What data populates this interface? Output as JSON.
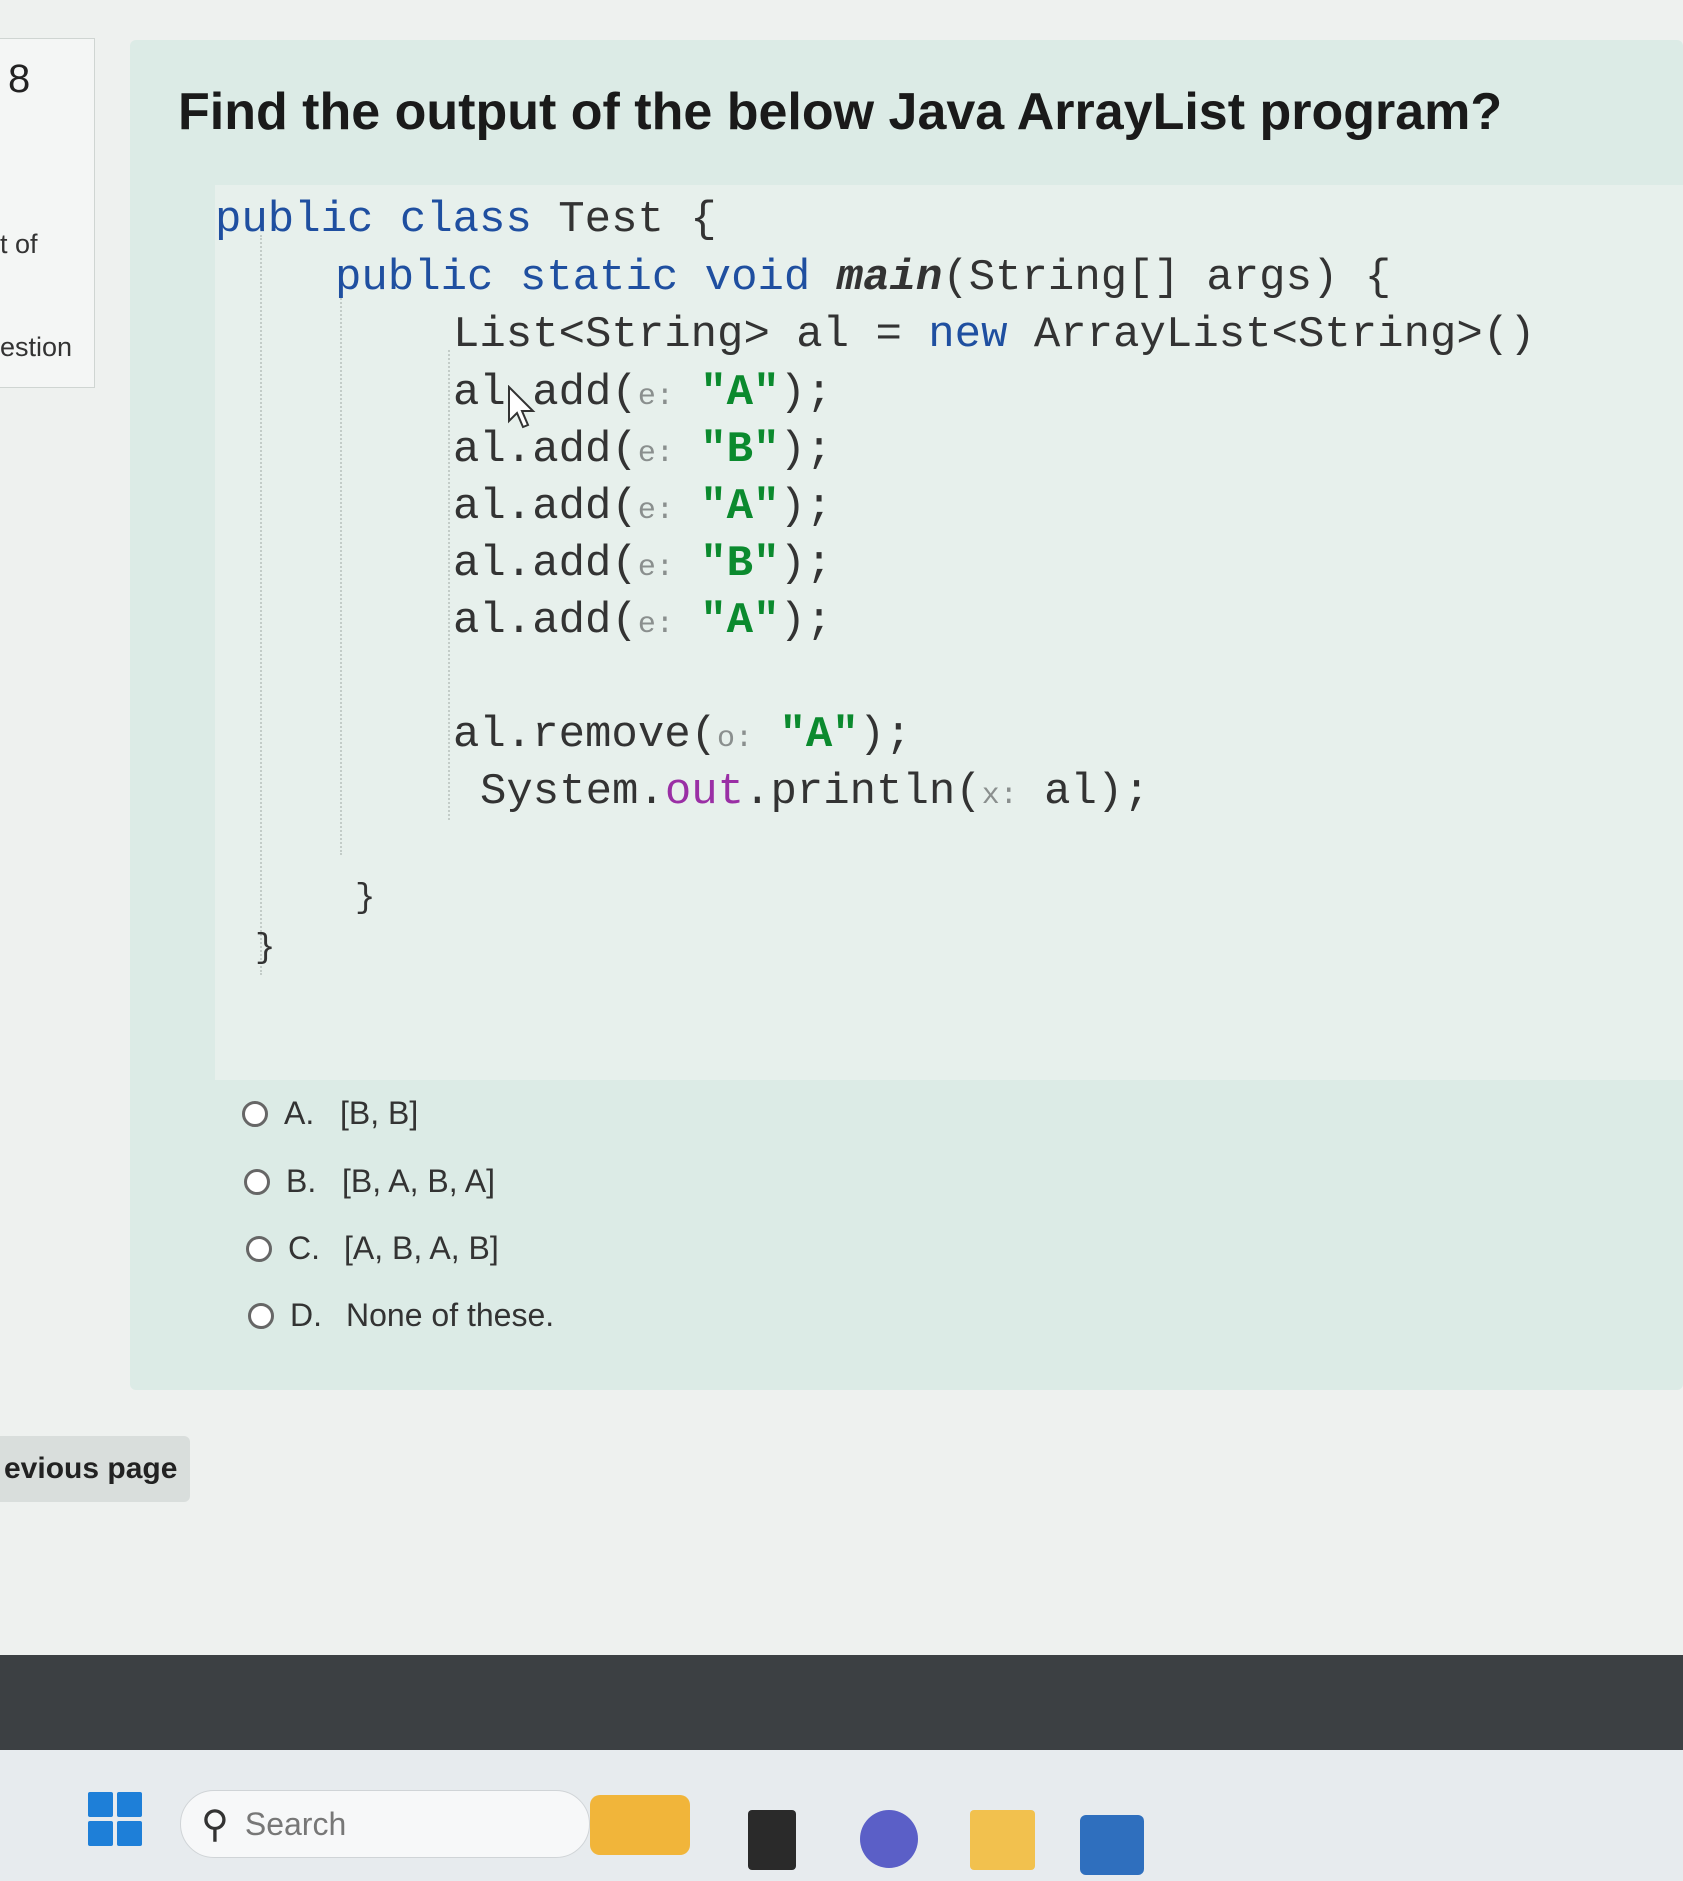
{
  "sidebar": {
    "question_number": "8",
    "line1": "t of",
    "line2": "estion"
  },
  "question": {
    "title": "Find the output of the below Java ArrayList program?"
  },
  "code": {
    "l1_kw": "public class",
    "l1_rest": " Test {",
    "l2_kw": "public static void",
    "l2_method": "main",
    "l2_rest": "(String[] args) {",
    "l3_a": "List<String> al = ",
    "l3_new": "new",
    "l3_b": " ArrayList<String>()",
    "add_call": "al.add(",
    "add_call_cursor": "al add(",
    "add_hint": "e:",
    "arg_a": "\"A\"",
    "arg_b": "\"B\"",
    "end": ");",
    "remove_call": "al.remove(",
    "remove_hint": "o:",
    "print_a": "System.",
    "print_field": "out",
    "print_b": ".println(",
    "print_hint": "x:",
    "print_c": " al);",
    "close_brace": "}"
  },
  "options": [
    {
      "letter": "A.",
      "text": "[B, B]"
    },
    {
      "letter": "B.",
      "text": "[B, A, B, A]"
    },
    {
      "letter": "C.",
      "text": "[A, B, A, B]"
    },
    {
      "letter": "D.",
      "text": "None of these."
    }
  ],
  "nav": {
    "previous_label": "evious page"
  },
  "taskbar": {
    "search_placeholder": "Search",
    "icons": [
      "windows-start-icon",
      "search-icon",
      "widgets-icon",
      "file-explorer-icon",
      "teams-icon",
      "folder-icon",
      "store-icon"
    ]
  }
}
